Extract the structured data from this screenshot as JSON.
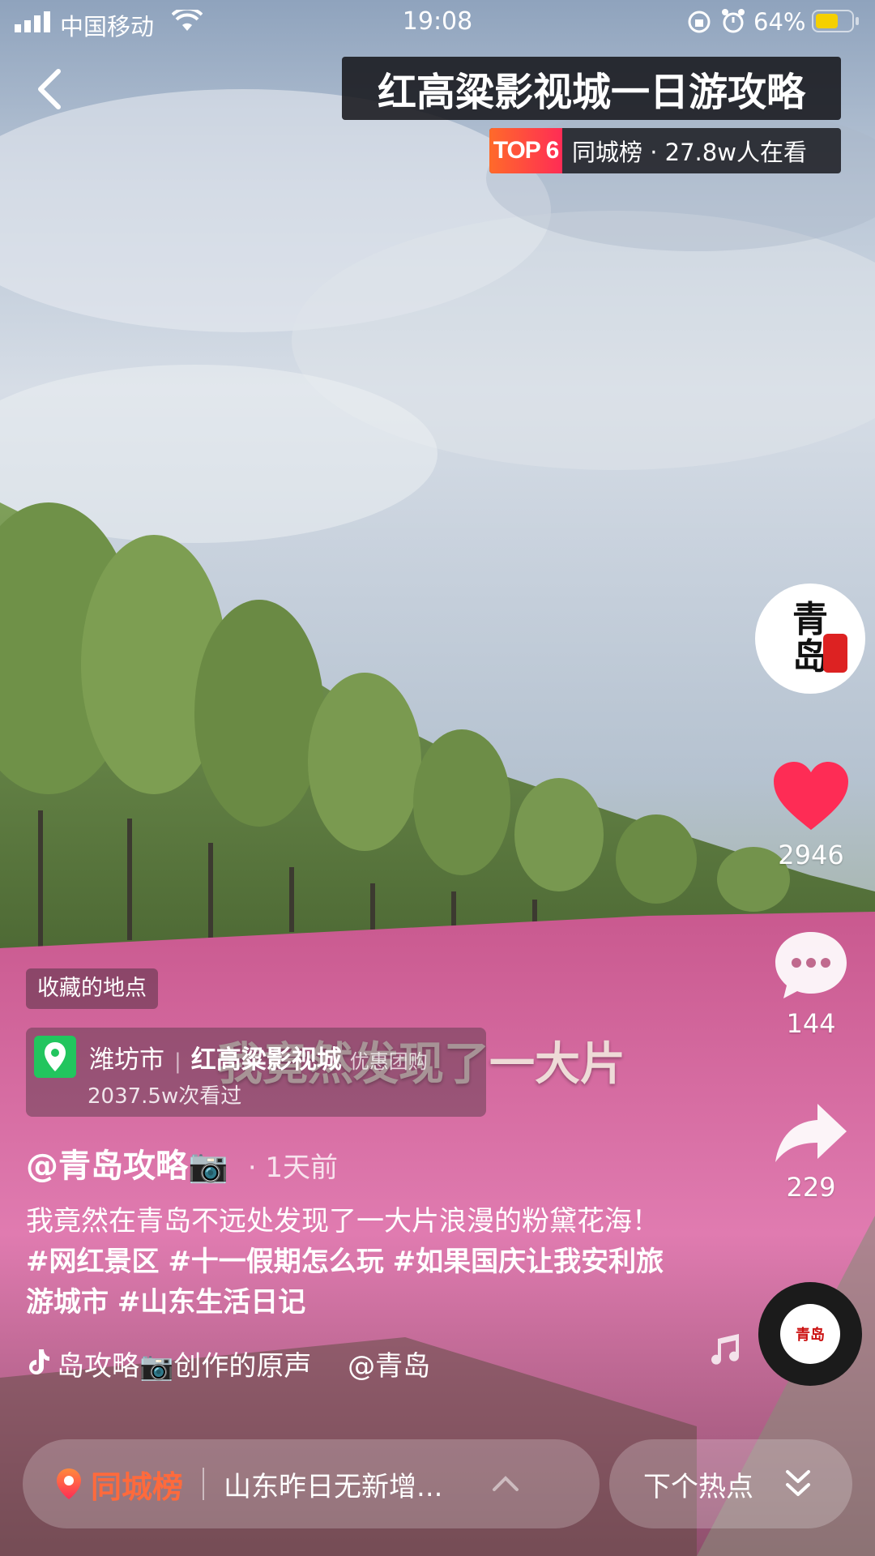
{
  "status_bar": {
    "carrier": "中国移动",
    "time": "19:08",
    "battery_percent": "64%",
    "battery_level": 0.64
  },
  "header": {
    "title": "红高粱影视城一日游攻略",
    "rank_badge": "TOP 6",
    "rank_text": "同城榜 · 27.8w人在看"
  },
  "video": {
    "subtitle_overlay": "我竟然发现了一大片"
  },
  "sidebar": {
    "avatar_icon": "qingdao-logo",
    "likes": "2946",
    "comments": "144",
    "shares": "229"
  },
  "info": {
    "favorite_tag": "收藏的地点",
    "poi_city": "潍坊市",
    "poi_name": "红高粱影视城",
    "poi_deal": "优惠团购",
    "poi_views": "2037.5w次看过",
    "author": "@青岛攻略📷",
    "posted": "· 1天前",
    "desc_plain_1": "我竟然在青岛不远处发现了一大片浪漫的粉黛花海！",
    "tag_1": "#网红景区",
    "tag_2": "#十一假期怎么玩",
    "tag_3": "#如果国庆让我安利旅游城市",
    "tag_4": "#山东生活日记",
    "music": "岛攻略📷创作的原声　 @青岛"
  },
  "bottom": {
    "hot_label": "同城榜",
    "hot_news": "山东昨日无新增...",
    "next_label": "下个热点"
  },
  "colors": {
    "like_red": "#fe2c55",
    "hot_orange": "#ff6a3c"
  }
}
